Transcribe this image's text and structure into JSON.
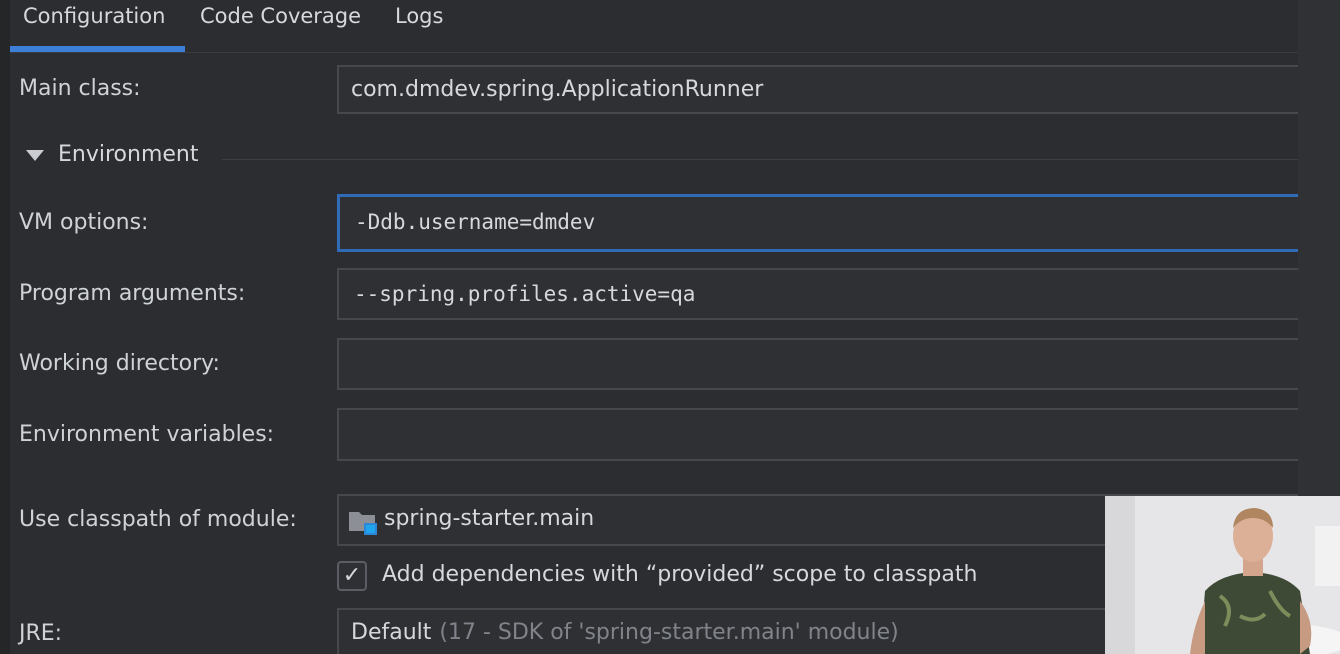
{
  "tabs": [
    {
      "label": "Configuration",
      "active": true
    },
    {
      "label": "Code Coverage",
      "active": false
    },
    {
      "label": "Logs",
      "active": false
    }
  ],
  "form": {
    "main_class": {
      "label": "Main class:",
      "value": "com.dmdev.spring.ApplicationRunner"
    },
    "environment_section": "Environment",
    "vm_options": {
      "label": "VM options:",
      "value": "-Ddb.username=dmdev"
    },
    "program_arguments": {
      "label": "Program arguments:",
      "value": "--spring.profiles.active=qa"
    },
    "working_directory": {
      "label": "Working directory:",
      "value": ""
    },
    "environment_variables": {
      "label": "Environment variables:",
      "value": ""
    },
    "classpath_module": {
      "label": "Use classpath of module:",
      "value": "spring-starter.main",
      "icon": "module-folder-icon"
    },
    "provided_scope": {
      "label": "Add dependencies with “provided” scope to classpath",
      "checked": true
    },
    "jre": {
      "label": "JRE:",
      "value": "Default",
      "hint": "(17 - SDK of 'spring-starter.main' module)"
    }
  },
  "colors": {
    "background": "#2b2d30",
    "accent": "#3d7fd6",
    "focus_border": "#2f6bb7",
    "field_bg": "#2e3034",
    "text": "#d6d8dc",
    "muted": "#80848a"
  }
}
